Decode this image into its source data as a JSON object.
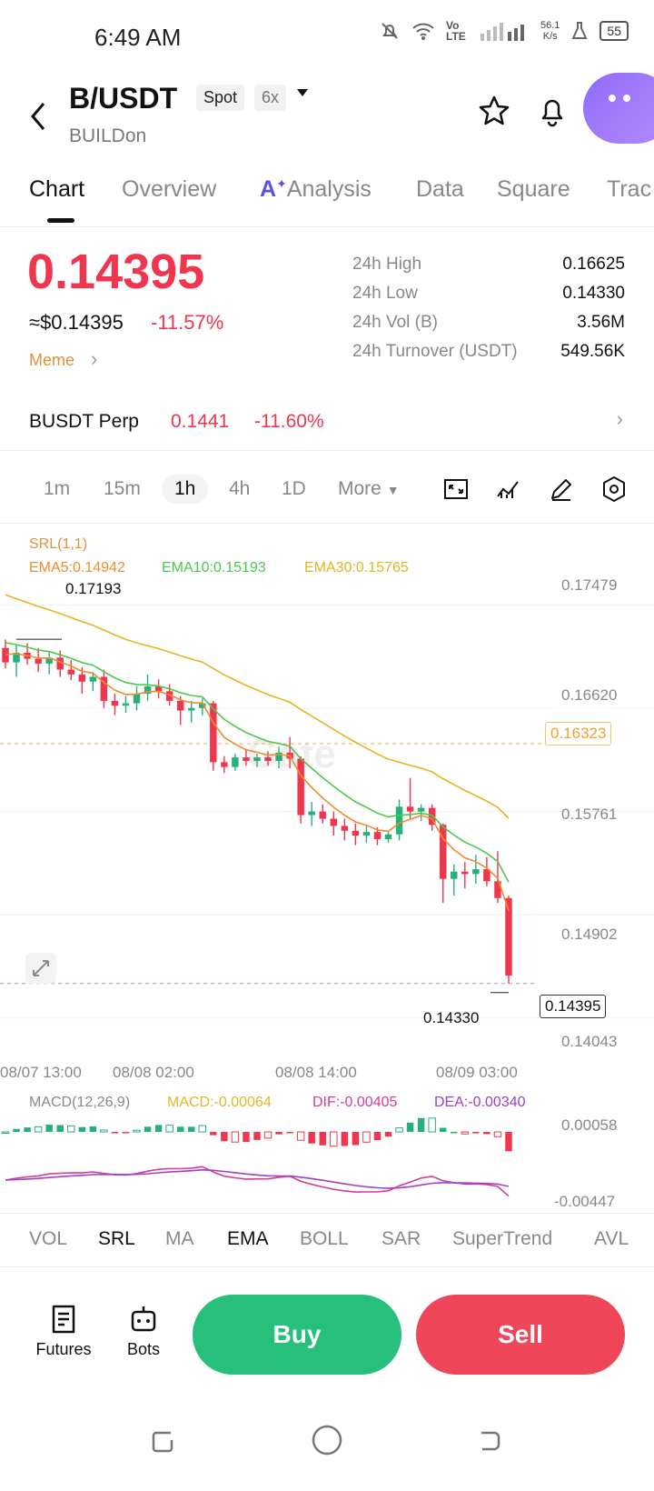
{
  "status_bar": {
    "time": "6:49 AM",
    "network": "Vo LTE",
    "speed_value": "56.1",
    "speed_unit": "K/s",
    "battery": "55"
  },
  "header": {
    "pair": "B/USDT",
    "market_type": "Spot",
    "leverage": "6x",
    "subtitle": "BUILDon",
    "icons": [
      "star-icon",
      "bell-icon",
      "assistant-icon"
    ]
  },
  "tabs": [
    {
      "label": "Chart",
      "active": true
    },
    {
      "label": "Overview",
      "active": false
    },
    {
      "label": "Analysis",
      "active": false,
      "ai_prefix": "A"
    },
    {
      "label": "Data",
      "active": false
    },
    {
      "label": "Square",
      "active": false
    },
    {
      "label": "Trac",
      "active": false
    }
  ],
  "price": {
    "last": "0.14395",
    "usd": "≈$0.14395",
    "change": "-11.57%",
    "tag": "Meme",
    "color_down": "#f0364e"
  },
  "stats": [
    {
      "label": "24h  High",
      "value": "0.16625"
    },
    {
      "label": "24h  Low",
      "value": "0.14330"
    },
    {
      "label": "24h  Vol (B)",
      "value": "3.56M"
    },
    {
      "label": "24h  Turnover (USDT)",
      "value": "549.56K"
    }
  ],
  "perp": {
    "name": "BUSDT Perp",
    "price": "0.1441",
    "change": "-11.60%"
  },
  "intervals": {
    "items": [
      "1m",
      "15m",
      "1h",
      "4h",
      "1D"
    ],
    "selected": "1h",
    "more": "More"
  },
  "chart_labels": {
    "srl": "SRL(1,1)",
    "ema5": "EMA5:0.14942",
    "ema10": "EMA10:0.15193",
    "ema30": "EMA30:0.15765",
    "high_marker": "0.17193",
    "low_marker": "0.14330",
    "current_price": "0.14395",
    "ref_line": "0.16323",
    "macd": "MACD(12,26,9)",
    "macd_val": "MACD:-0.00064",
    "dif_val": "DIF:-0.00405",
    "dea_val": "DEA:-0.00340",
    "macd_top": "0.00058",
    "macd_bottom": "-0.00447",
    "watermark": "Gate"
  },
  "chart_data": {
    "type": "candlestick",
    "interval": "1h",
    "y_axis_ticks": [
      "0.17479",
      "0.16620",
      "0.15761",
      "0.14902",
      "0.14043"
    ],
    "x_axis_ticks": [
      "08/07 13:00",
      "08/08 02:00",
      "08/08 14:00",
      "08/09 03:00"
    ],
    "ylim": [
      0.1392,
      0.177
    ],
    "candles": [
      {
        "o": 0.1712,
        "h": 0.1719,
        "l": 0.1695,
        "c": 0.17
      },
      {
        "o": 0.17,
        "h": 0.1715,
        "l": 0.1688,
        "c": 0.1708
      },
      {
        "o": 0.1708,
        "h": 0.1716,
        "l": 0.1698,
        "c": 0.1703
      },
      {
        "o": 0.1703,
        "h": 0.1712,
        "l": 0.1692,
        "c": 0.1699
      },
      {
        "o": 0.1699,
        "h": 0.1709,
        "l": 0.169,
        "c": 0.1704
      },
      {
        "o": 0.1704,
        "h": 0.171,
        "l": 0.1688,
        "c": 0.1694
      },
      {
        "o": 0.1694,
        "h": 0.1702,
        "l": 0.1685,
        "c": 0.169
      },
      {
        "o": 0.169,
        "h": 0.1696,
        "l": 0.1674,
        "c": 0.1684
      },
      {
        "o": 0.1684,
        "h": 0.1692,
        "l": 0.1676,
        "c": 0.1688
      },
      {
        "o": 0.1688,
        "h": 0.1694,
        "l": 0.1662,
        "c": 0.1668
      },
      {
        "o": 0.1668,
        "h": 0.1674,
        "l": 0.1656,
        "c": 0.1664
      },
      {
        "o": 0.1664,
        "h": 0.1672,
        "l": 0.1658,
        "c": 0.1666
      },
      {
        "o": 0.1666,
        "h": 0.168,
        "l": 0.166,
        "c": 0.1674
      },
      {
        "o": 0.1674,
        "h": 0.169,
        "l": 0.1668,
        "c": 0.168
      },
      {
        "o": 0.168,
        "h": 0.1686,
        "l": 0.167,
        "c": 0.1676
      },
      {
        "o": 0.1676,
        "h": 0.1682,
        "l": 0.1664,
        "c": 0.1668
      },
      {
        "o": 0.1668,
        "h": 0.1672,
        "l": 0.1648,
        "c": 0.166
      },
      {
        "o": 0.166,
        "h": 0.1668,
        "l": 0.165,
        "c": 0.1662
      },
      {
        "o": 0.1662,
        "h": 0.167,
        "l": 0.1656,
        "c": 0.1666
      },
      {
        "o": 0.1666,
        "h": 0.1668,
        "l": 0.161,
        "c": 0.1617
      },
      {
        "o": 0.1617,
        "h": 0.1622,
        "l": 0.1608,
        "c": 0.1613
      },
      {
        "o": 0.1613,
        "h": 0.1624,
        "l": 0.161,
        "c": 0.1621
      },
      {
        "o": 0.1621,
        "h": 0.1628,
        "l": 0.1614,
        "c": 0.1618
      },
      {
        "o": 0.1618,
        "h": 0.1624,
        "l": 0.1613,
        "c": 0.1621
      },
      {
        "o": 0.1621,
        "h": 0.1626,
        "l": 0.1614,
        "c": 0.1618
      },
      {
        "o": 0.1618,
        "h": 0.163,
        "l": 0.1612,
        "c": 0.1625
      },
      {
        "o": 0.1625,
        "h": 0.1638,
        "l": 0.1612,
        "c": 0.162
      },
      {
        "o": 0.162,
        "h": 0.1622,
        "l": 0.1566,
        "c": 0.1573
      },
      {
        "o": 0.1573,
        "h": 0.1584,
        "l": 0.1564,
        "c": 0.1576
      },
      {
        "o": 0.1576,
        "h": 0.1582,
        "l": 0.1566,
        "c": 0.157
      },
      {
        "o": 0.157,
        "h": 0.1576,
        "l": 0.1556,
        "c": 0.1564
      },
      {
        "o": 0.1564,
        "h": 0.157,
        "l": 0.1552,
        "c": 0.156
      },
      {
        "o": 0.156,
        "h": 0.1566,
        "l": 0.1548,
        "c": 0.1556
      },
      {
        "o": 0.1556,
        "h": 0.1564,
        "l": 0.155,
        "c": 0.1559
      },
      {
        "o": 0.1559,
        "h": 0.1563,
        "l": 0.1548,
        "c": 0.1553
      },
      {
        "o": 0.1553,
        "h": 0.156,
        "l": 0.155,
        "c": 0.1557
      },
      {
        "o": 0.1557,
        "h": 0.1586,
        "l": 0.1552,
        "c": 0.158
      },
      {
        "o": 0.158,
        "h": 0.1604,
        "l": 0.157,
        "c": 0.1576
      },
      {
        "o": 0.1576,
        "h": 0.1582,
        "l": 0.1568,
        "c": 0.1579
      },
      {
        "o": 0.1579,
        "h": 0.1582,
        "l": 0.156,
        "c": 0.1565
      },
      {
        "o": 0.1565,
        "h": 0.1566,
        "l": 0.15,
        "c": 0.152
      },
      {
        "o": 0.152,
        "h": 0.1532,
        "l": 0.1506,
        "c": 0.1526
      },
      {
        "o": 0.1526,
        "h": 0.1534,
        "l": 0.1512,
        "c": 0.1524
      },
      {
        "o": 0.1524,
        "h": 0.154,
        "l": 0.1516,
        "c": 0.1528
      },
      {
        "o": 0.1528,
        "h": 0.1538,
        "l": 0.1514,
        "c": 0.1518
      },
      {
        "o": 0.1518,
        "h": 0.1543,
        "l": 0.15,
        "c": 0.1504
      },
      {
        "o": 0.1504,
        "h": 0.1506,
        "l": 0.1433,
        "c": 0.14395
      }
    ],
    "ema5_last": 0.14942,
    "ema10_last": 0.15193,
    "ema30_last": 0.15765,
    "macd_range": [
      -0.00447,
      0.00058
    ]
  },
  "indicator_tabs": [
    {
      "label": "VOL",
      "on": false
    },
    {
      "label": "SRL",
      "on": true
    },
    {
      "label": "MA",
      "on": false
    },
    {
      "label": "EMA",
      "on": true
    },
    {
      "label": "BOLL",
      "on": false
    },
    {
      "label": "SAR",
      "on": false
    },
    {
      "label": "SuperTrend",
      "on": false
    },
    {
      "label": "AVL",
      "on": false
    }
  ],
  "bottom": {
    "futures": "Futures",
    "bots": "Bots",
    "buy": "Buy",
    "sell": "Sell"
  },
  "colors": {
    "up": "#26b07a",
    "down": "#f0364e",
    "ema5": "#f08c2e",
    "ema10": "#4cc94c",
    "ema30": "#e6b422",
    "dif": "#d63c9a",
    "dea": "#a040c8",
    "accent": "#5a53e5"
  }
}
